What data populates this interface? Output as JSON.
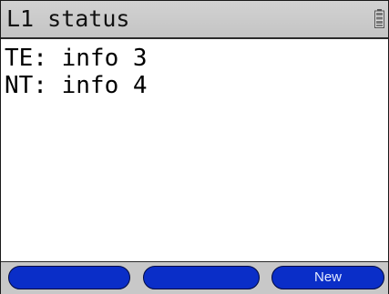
{
  "header": {
    "title": "L1 status",
    "battery_icon": "battery-icon"
  },
  "status_lines": [
    "TE: info 3",
    "NT: info 4"
  ],
  "softkeys": [
    {
      "label": ""
    },
    {
      "label": ""
    },
    {
      "label": "New"
    }
  ],
  "colors": {
    "title_bar": "#c8c8c8",
    "softkey": "#0a2ec8",
    "softkey_text": "#e6ecff"
  }
}
